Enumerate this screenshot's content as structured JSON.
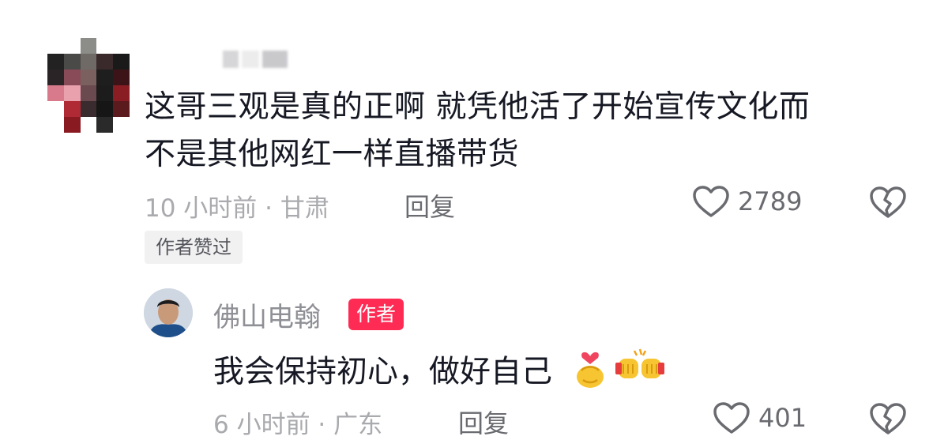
{
  "comment": {
    "text_line1": "这哥三观是真的正啊 就凭他活了开始宣传文化而",
    "text_line2": "不是其他网红一样直播带货",
    "meta": "10 小时前 · 甘肃",
    "reply_label": "回复",
    "like_count": "2789",
    "author_liked_label": "作者赞过"
  },
  "reply": {
    "username": "佛山电翰",
    "author_badge": "作者",
    "text": "我会保持初心，做好自己",
    "emojis": [
      "finger-heart-emoji",
      "fist-bump-emoji"
    ],
    "meta": "6 小时前 · 广东",
    "reply_label": "回复",
    "like_count": "401"
  },
  "colors": {
    "accent": "#fe2c55",
    "text_primary": "#161823",
    "text_meta": "#a9aaae",
    "text_secondary": "#6a6b70",
    "tag_bg": "#f1f1f2"
  },
  "icons": [
    "heart-outline-icon",
    "broken-heart-icon"
  ]
}
